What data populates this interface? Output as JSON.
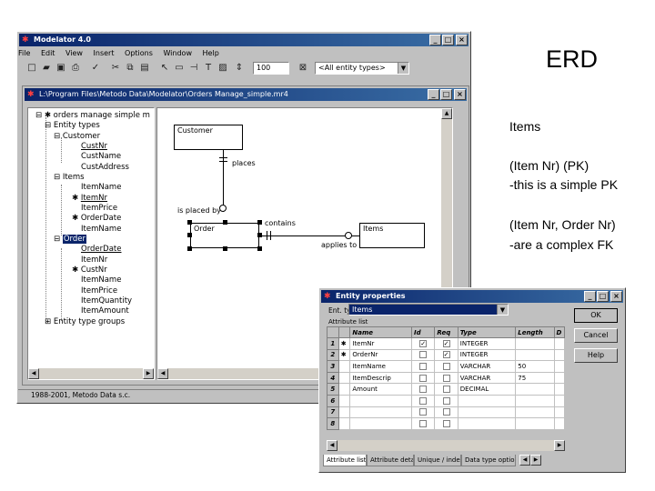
{
  "slide": {
    "title": "ERD",
    "lines": [
      "Items",
      "(Item Nr)  (PK)",
      "-this is a simple PK",
      "(Item Nr, Order Nr)",
      "-are a complex FK"
    ]
  },
  "main_window": {
    "title": "Modelator 4.0",
    "min": "_",
    "max": "□",
    "close": "×",
    "menu": [
      "File",
      "Edit",
      "View",
      "Insert",
      "Options",
      "Window",
      "Help"
    ],
    "zoom_value": "100",
    "entity_filter": "<All entity types>",
    "status": "1988-2001, Metodo Data s.c."
  },
  "doc_window": {
    "title": "L:\\Program Files\\Metodo Data\\Modelator\\Orders Manage_simple.mr4"
  },
  "tree": {
    "root": "orders manage simple m",
    "entity_types": "Entity types",
    "customer": "Customer",
    "customer_attrs": [
      "CustNr",
      "CustName",
      "CustAddress"
    ],
    "items": "Items",
    "items_attrs": [
      "ItemName",
      "ItemNr",
      "ItemPrice",
      "OrderDate",
      "ItemName"
    ],
    "order": "Order",
    "order_attrs": [
      "OrderDate",
      "ItemNr",
      "CustNr",
      "ItemName",
      "ItemPrice",
      "ItemQuantity",
      "ItemAmount"
    ],
    "groups": "Entity type groups"
  },
  "erd": {
    "customer": "Customer",
    "places": "places",
    "is_placed_by": "is placed by",
    "order": "Order",
    "contains": "contains",
    "items": "Items",
    "applies_to": "applies to"
  },
  "dialog": {
    "title": "Entity properties",
    "ent_type_label": "Ent. type",
    "ent_type_value": "Items",
    "attr_list_label": "Attribute list",
    "ok": "OK",
    "cancel": "Cancel",
    "help": "Help",
    "columns": [
      "Name",
      "Id",
      "Req",
      "Type",
      "Length",
      "D"
    ],
    "rows": [
      {
        "n": "1",
        "key": "✱",
        "name": "ItemNr",
        "id": true,
        "req": true,
        "type": "INTEGER",
        "len": ""
      },
      {
        "n": "2",
        "key": "✱",
        "name": "OrderNr",
        "id": false,
        "req": true,
        "type": "INTEGER",
        "len": ""
      },
      {
        "n": "3",
        "key": "",
        "name": "ItemName",
        "id": false,
        "req": false,
        "type": "VARCHAR",
        "len": "50"
      },
      {
        "n": "4",
        "key": "",
        "name": "ItemDescrip",
        "id": false,
        "req": false,
        "type": "VARCHAR",
        "len": "75"
      },
      {
        "n": "5",
        "key": "",
        "name": "Amount",
        "id": false,
        "req": false,
        "type": "DECIMAL",
        "len": ""
      },
      {
        "n": "6",
        "key": "",
        "name": "",
        "id": false,
        "req": false,
        "type": "",
        "len": ""
      },
      {
        "n": "7",
        "key": "",
        "name": "",
        "id": false,
        "req": false,
        "type": "",
        "len": ""
      },
      {
        "n": "8",
        "key": "",
        "name": "",
        "id": false,
        "req": false,
        "type": "",
        "len": ""
      }
    ],
    "tabs": [
      "Attribute list",
      "Attribute details",
      "Unique / index",
      "Data type options"
    ]
  }
}
